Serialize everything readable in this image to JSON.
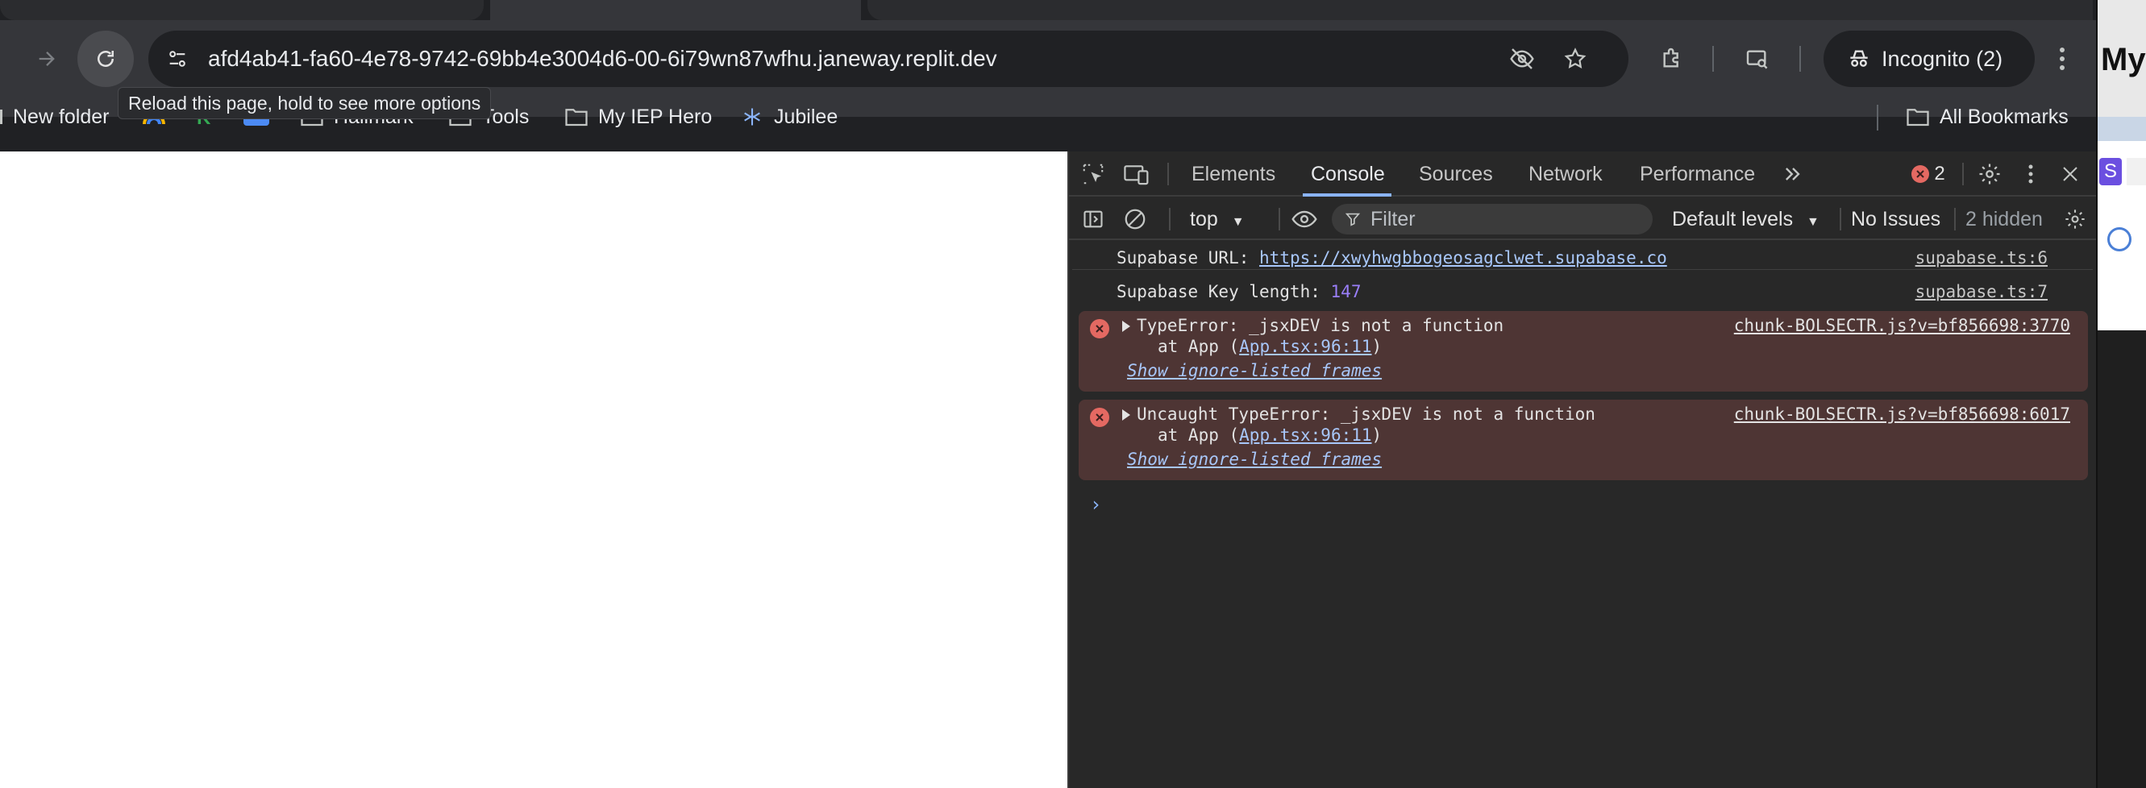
{
  "browser": {
    "url": "afd4ab41-fa60-4e78-9742-69bb4e3004d6-00-6i79wn87wfhu.janeway.replit.dev",
    "incognito_label": "Incognito (2)",
    "tooltip": "Reload this page, hold to see more options",
    "bookmarks": [
      {
        "label": "New folder",
        "icon": "folder-icon"
      },
      {
        "label": "Hallmark",
        "icon": "folder-icon"
      },
      {
        "label": "Tools",
        "icon": "folder-icon"
      },
      {
        "label": "My IEP Hero",
        "icon": "folder-icon"
      },
      {
        "label": "Jubilee",
        "icon": "jubilee-icon"
      }
    ],
    "all_bookmarks": "All Bookmarks"
  },
  "devtools": {
    "tabs": [
      "Elements",
      "Console",
      "Sources",
      "Network",
      "Performance"
    ],
    "active_tab": "Console",
    "error_count": "2",
    "console_bar": {
      "context": "top",
      "filter_placeholder": "Filter",
      "levels": "Default levels",
      "issues": "No Issues",
      "hidden": "2 hidden"
    },
    "logs": [
      {
        "label": "Supabase URL:",
        "value": "https://xwyhwgbbogeosagclwet.supabase.co",
        "source": "supabase.ts:6"
      },
      {
        "label": "Supabase Key length:",
        "value": "147",
        "source": "supabase.ts:7"
      }
    ],
    "errors": [
      {
        "message": "TypeError: _jsxDEV is not a function",
        "at_prefix": "at App (",
        "at_link": "App.tsx:96:11",
        "at_suffix": ")",
        "ignore": "Show ignore-listed frames",
        "source": "chunk-BOLSECTR.js?v=bf856698:3770"
      },
      {
        "message": "Uncaught TypeError: _jsxDEV is not a function",
        "at_prefix": "at App (",
        "at_link": "App.tsx:96:11",
        "at_suffix": ")",
        "ignore": "Show ignore-listed frames",
        "source": "chunk-BOLSECTR.js?v=bf856698:6017"
      }
    ]
  },
  "side_window": {
    "title_fragment": "My"
  },
  "colors": {
    "accent": "#8ab4f8",
    "error_bg": "#4e3534",
    "error_icon": "#e46962"
  }
}
